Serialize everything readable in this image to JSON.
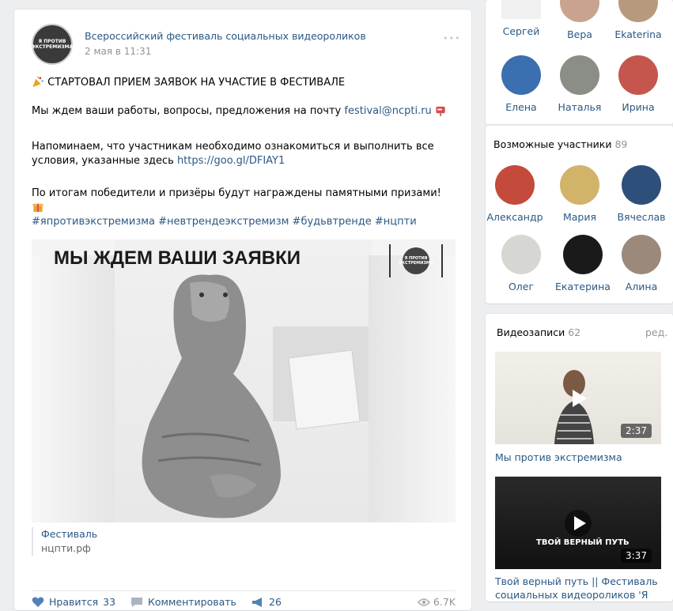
{
  "post": {
    "author": "Всероссийский фестиваль социальных видеороликов",
    "date": "2 мая в 11:31",
    "avatar_text": [
      "Я ПРОТИВ",
      "ЭКСТРЕМИЗМА"
    ],
    "line1": "СТАРТОВАЛ ПРИЕМ ЗАЯВОК НА УЧАСТИЕ В ФЕСТИВАЛЕ",
    "line2_text": "Мы ждем ваши работы, вопросы, предложения на почту ",
    "line2_link": "festival@ncpti.ru",
    "line3_text": "Напоминаем, что участникам необходимо ознакомиться и выполнить все условия, указанные здесь ",
    "line3_link": "https://goo.gl/DFIAY1",
    "line4": "По итогам победители и призёры будут награждены памятными призами!",
    "hashtags": "#япротивэкстремизма #невтрендеэкстремизм #будьвтренде #нцпти",
    "image_headline": "МЫ ЖДЕМ ВАШИ ЗАЯВКИ",
    "link_title": "Фестиваль",
    "link_url": "нцпти.рф",
    "likes_label": "Нравится",
    "likes_count": "33",
    "comment_label": "Комментировать",
    "shares_count": "26",
    "views": "6.7K"
  },
  "members_top": [
    "Сергей",
    "Вера",
    "Ekaterina",
    "Елена",
    "Наталья",
    "Ирина"
  ],
  "possible": {
    "title": "Возможные участники",
    "count": "89",
    "people": [
      "Александр",
      "Мария",
      "Вячеслав",
      "Олег",
      "Екатерина",
      "Алина"
    ]
  },
  "videos": {
    "title": "Видеозаписи",
    "count": "62",
    "edit": "ред.",
    "items": [
      {
        "title": "Мы против экстремизма",
        "duration": "2:37"
      },
      {
        "title": "Твой верный путь || Фестиваль социальных видеороликов 'Я",
        "duration": "3:37",
        "overlay": "ТВОЙ ВЕРНЫЙ ПУТЬ"
      }
    ]
  },
  "colors": {
    "link": "#2a5885",
    "muted": "#939393"
  }
}
